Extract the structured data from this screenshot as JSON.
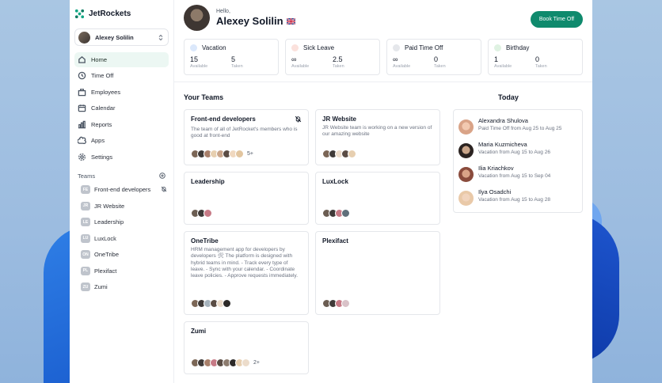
{
  "brand": {
    "name": "JetRockets"
  },
  "current_user": {
    "name": "Alexey Solilin"
  },
  "nav": [
    {
      "label": "Home",
      "icon": "home-icon",
      "active": true
    },
    {
      "label": "Time Off",
      "icon": "clock-icon"
    },
    {
      "label": "Employees",
      "icon": "employees-icon"
    },
    {
      "label": "Calendar",
      "icon": "calendar-icon"
    },
    {
      "label": "Reports",
      "icon": "chart-icon"
    },
    {
      "label": "Apps",
      "icon": "apps-icon"
    },
    {
      "label": "Settings",
      "icon": "gear-icon"
    }
  ],
  "teams_section": {
    "label": "Teams"
  },
  "teams": [
    {
      "badge": "FE",
      "label": "Front-end developers",
      "muted": true
    },
    {
      "badge": "JR",
      "label": "JR Website"
    },
    {
      "badge": "LE",
      "label": "Leadership"
    },
    {
      "badge": "LU",
      "label": "LuxLock"
    },
    {
      "badge": "ON",
      "label": "OneTribe"
    },
    {
      "badge": "PL",
      "label": "Plexifact"
    },
    {
      "badge": "ZU",
      "label": "Zumi"
    }
  ],
  "header": {
    "greeting": "Hello,",
    "name": "Alexey Solilin",
    "book_button": "Book Time Off"
  },
  "stats": [
    {
      "label": "Vacation",
      "color": "#dbe8fb",
      "available": "15",
      "taken": "5"
    },
    {
      "label": "Sick Leave",
      "color": "#fbe1dc",
      "available": "∞",
      "taken": "2.5"
    },
    {
      "label": "Paid Time Off",
      "color": "#e5e7eb",
      "available": "∞",
      "taken": "0"
    },
    {
      "label": "Birthday",
      "color": "#dff2e2",
      "available": "1",
      "taken": "0"
    }
  ],
  "stat_labels": {
    "available": "Available",
    "taken": "Taken"
  },
  "your_teams": {
    "title": "Your Teams",
    "cards": [
      {
        "title": "Front-end developers",
        "desc": "The team of all of JetRocket's members who is good at front-end",
        "more": "5+",
        "muted": true
      },
      {
        "title": "JR Website",
        "desc": "JR Website team is working on a new version of our amazing website",
        "more": ""
      },
      {
        "title": "Leadership",
        "desc": "",
        "more": ""
      },
      {
        "title": "LuxLock",
        "desc": "",
        "more": ""
      },
      {
        "title": "OneTribe",
        "desc": "HRM management app for developers by developers 🛠 The platform is designed with hybrid teams in mind. - Track every type of leave. - Sync with your calendar. - Coordinate leave policies. - Approve requests immediately.",
        "more": ""
      },
      {
        "title": "Plexifact",
        "desc": "",
        "more": ""
      },
      {
        "title": "Zumi",
        "desc": "",
        "more": "2+"
      }
    ]
  },
  "today": {
    "title": "Today",
    "entries": [
      {
        "name": "Alexandra Shulova",
        "info": "Paid Time Off from Aug 25 to Aug 25"
      },
      {
        "name": "Maria Kuzmicheva",
        "info": "Vacation from Aug 15 to Aug 26"
      },
      {
        "name": "Ilia Kriachkov",
        "info": "Vacation from Aug 15 to Sep 04"
      },
      {
        "name": "Ilya Osadchi",
        "info": "Vacation from Aug 15 to Aug 28"
      }
    ]
  }
}
